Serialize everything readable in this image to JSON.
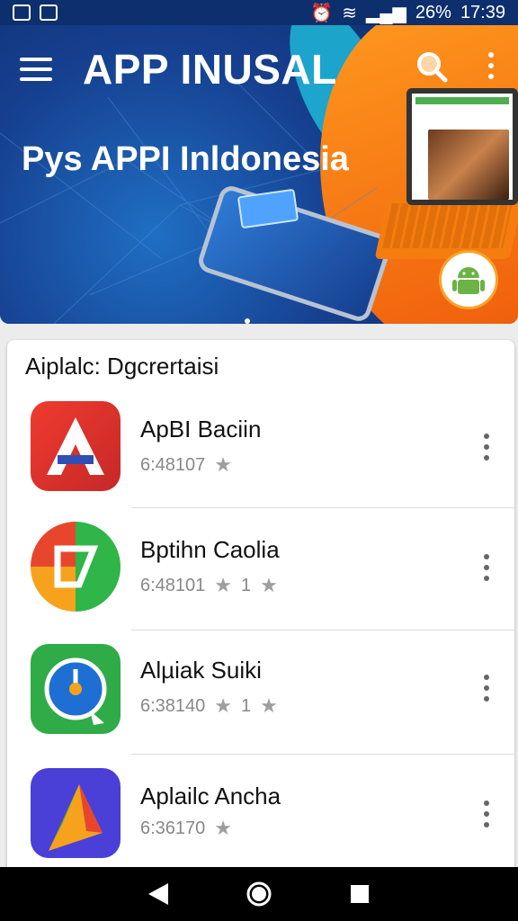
{
  "status_bar": {
    "battery": "26%",
    "time": "17:39"
  },
  "header": {
    "title": "APP INUSAL",
    "menu_icon": "hamburger-menu-icon",
    "search_icon": "search-icon",
    "more_icon": "more-vert-icon"
  },
  "hero": {
    "subtitle": "Pys APPI Inldonesia"
  },
  "section": {
    "title": "Aiplalc: Dgcrertaisi"
  },
  "apps": [
    {
      "name": "ApBI Baciin",
      "meta": "6:48107",
      "rating": ""
    },
    {
      "name": "Bptihn Caolia",
      "meta": "6:48101",
      "rating": "1"
    },
    {
      "name": "Alµiak Suiki",
      "meta": "6:38140",
      "rating": "1"
    },
    {
      "name": "Aplailc Ancha",
      "meta": "6:36170",
      "rating": ""
    }
  ],
  "nav": {
    "back": "back-triangle-icon",
    "home": "home-circle-icon",
    "recents": "recents-square-icon"
  },
  "colors": {
    "hero_blue": "#163f8f",
    "hero_orange": "#ef5a0a",
    "accent_cyan": "#1fb7d8"
  }
}
